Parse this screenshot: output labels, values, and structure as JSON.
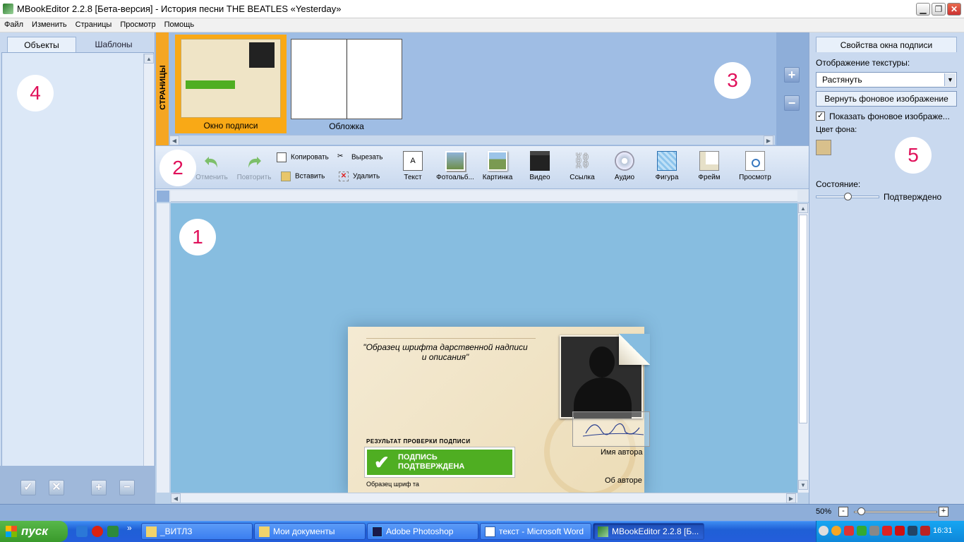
{
  "window": {
    "title": "MBookEditor 2.2.8 [Бета-версия] - История песни THE BEATLES «Yesterday»",
    "min_label": "▁",
    "max_label": "❐",
    "close_label": "✕"
  },
  "menu": [
    "Файл",
    "Изменить",
    "Страницы",
    "Просмотр",
    "Помощь"
  ],
  "left_panel": {
    "tabs": [
      "Объекты",
      "Шаблоны"
    ],
    "bottom_buttons": [
      "confirm",
      "cancel",
      "add",
      "remove"
    ],
    "callout": "4"
  },
  "pages_strip": {
    "label": "СТРАНИЦЫ",
    "pages": [
      {
        "label": "Окно подписи",
        "selected": true
      },
      {
        "label": "Обложка",
        "selected": false
      }
    ],
    "callout": "3"
  },
  "toolbar": {
    "undo": "Отменить",
    "redo": "Повторить",
    "copy": "Копировать",
    "cut": "Вырезать",
    "paste": "Вставить",
    "delete": "Удалить",
    "tools": [
      "Текст",
      "Фотоальб...",
      "Картинка",
      "Видео",
      "Ссылка",
      "Аудио",
      "Фигура",
      "Фрейм",
      "Просмотр"
    ],
    "callout": "2"
  },
  "canvas": {
    "callout": "1",
    "page": {
      "quote": "\"Образец шрифта дарственной надписи и описания\"",
      "result_title": "РЕЗУЛЬТАТ ПРОВЕРКИ ПОДПИСИ",
      "banner_line1": "ПОДПИСЬ",
      "banner_line2": "ПОДТВЕРЖДЕНА",
      "font_sample": "Образец шриф та",
      "author_name": "Имя автора",
      "about_author": "Об авторе"
    }
  },
  "right_panel": {
    "tab": "Свойства окна подписи",
    "texture_label": "Отображение текстуры:",
    "texture_value": "Растянуть",
    "restore_button": "Вернуть фоновое изображение",
    "show_bg_label": "Показать фоновое изображе...",
    "show_bg_checked": true,
    "bg_color_label": "Цвет фона:",
    "bg_color": "#d8c08c",
    "state_label": "Состояние:",
    "state_value": "Подтверждено",
    "state_level": 0.5,
    "callout": "5"
  },
  "status": {
    "zoom": "50%",
    "zoom_level": 0.1
  },
  "taskbar": {
    "start": "пуск",
    "tasks": [
      "_ВИТЛЗ",
      "Мои документы",
      "Adobe Photoshop",
      "текст - Microsoft Word",
      "MBookEditor 2.2.8 [Б..."
    ],
    "active_task": 4,
    "clock": "16:31"
  },
  "colors": {
    "accent": "#f9a916",
    "canvas_bg": "#87bde0",
    "confirm_green": "#4fae22",
    "callout": "#e0105a"
  }
}
